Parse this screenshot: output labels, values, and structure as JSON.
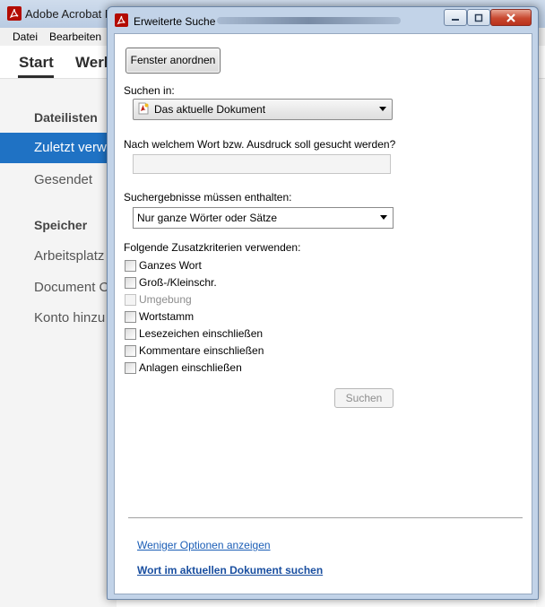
{
  "background_window": {
    "title": "Adobe Acrobat R",
    "menu": [
      "Datei",
      "Bearbeiten"
    ],
    "tabs": [
      "Start",
      "Werk"
    ],
    "sidebar": {
      "heading_files": "Dateilisten",
      "recent": "Zuletzt verw",
      "sent": "Gesendet",
      "heading_storage": "Speicher",
      "workplace": "Arbeitsplatz",
      "document_cloud": "Document C",
      "add_account": "Konto hinzu"
    }
  },
  "dialog": {
    "title": "Erweiterte Suche",
    "arrange_button": "Fenster anordnen",
    "search_in_label": "Suchen in:",
    "search_in_value": "Das aktuelle Dokument",
    "query_label": "Nach welchem Wort bzw. Ausdruck soll gesucht werden?",
    "query_value": "",
    "results_label": "Suchergebnisse müssen enthalten:",
    "results_value": "Nur ganze Wörter oder Sätze",
    "criteria_label": "Folgende Zusatzkriterien verwenden:",
    "criteria": [
      {
        "label": "Ganzes Wort",
        "checked": false,
        "enabled": true
      },
      {
        "label": "Groß-/Kleinschr.",
        "checked": false,
        "enabled": true
      },
      {
        "label": "Umgebung",
        "checked": false,
        "enabled": false
      },
      {
        "label": "Wortstamm",
        "checked": false,
        "enabled": true
      },
      {
        "label": "Lesezeichen einschließen",
        "checked": false,
        "enabled": true
      },
      {
        "label": "Kommentare einschließen",
        "checked": false,
        "enabled": true
      },
      {
        "label": "Anlagen einschließen",
        "checked": false,
        "enabled": true
      }
    ],
    "search_button": "Suchen",
    "link_fewer_options": "Weniger Optionen anzeigen",
    "link_search_current": "Wort im aktuellen Dokument suchen"
  },
  "colors": {
    "accent_selected": "#1f72c4",
    "link": "#1a5db6",
    "close_button": "#c8482f"
  }
}
